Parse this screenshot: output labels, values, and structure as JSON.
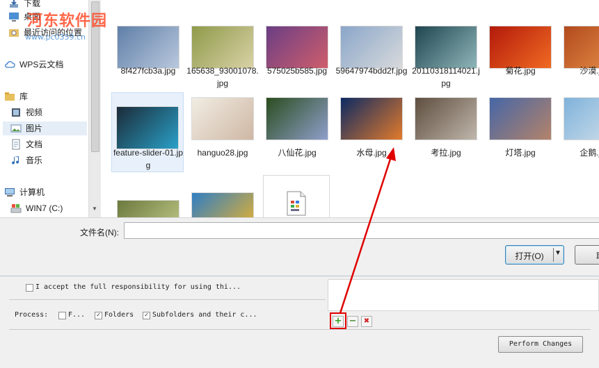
{
  "sidebar": {
    "items": [
      {
        "label": "下载",
        "icon": "download-icon"
      },
      {
        "label": "桌面",
        "icon": "desktop-icon"
      },
      {
        "label": "最近访问的位置",
        "icon": "recent-places-icon"
      },
      {
        "label": "WPS云文档",
        "icon": "cloud-icon"
      },
      {
        "label": "库",
        "icon": "library-icon"
      },
      {
        "label": "视频",
        "icon": "video-icon"
      },
      {
        "label": "图片",
        "icon": "pictures-icon"
      },
      {
        "label": "文档",
        "icon": "document-icon"
      },
      {
        "label": "音乐",
        "icon": "music-icon"
      },
      {
        "label": "计算机",
        "icon": "computer-icon"
      },
      {
        "label": "WIN7 (C:)",
        "icon": "drive-icon"
      }
    ]
  },
  "files": [
    {
      "name": "8f427fcb3a.jpg",
      "colors": [
        "#5f7fa8",
        "#b9c8dd"
      ]
    },
    {
      "name": "165638_93001078.jpg",
      "colors": [
        "#8f9a4a",
        "#d9d2a6"
      ]
    },
    {
      "name": "575025b585.jpg",
      "colors": [
        "#6a3e84",
        "#cf5e6c"
      ]
    },
    {
      "name": "59647974bdd2f.jpg",
      "colors": [
        "#8aa6c9",
        "#d8dadc"
      ]
    },
    {
      "name": "20110318114021.jpg",
      "colors": [
        "#1f4550",
        "#8fb6b9"
      ]
    },
    {
      "name": "菊花.jpg",
      "colors": [
        "#b31a0a",
        "#f06a23"
      ]
    },
    {
      "name": "沙漠.jpg",
      "colors": [
        "#b24a1d",
        "#e8924b"
      ]
    },
    {
      "name": "feature-slider-01.jpg",
      "colors": [
        "#1b2b38",
        "#2aa0c8"
      ]
    },
    {
      "name": "hanguo28.jpg",
      "colors": [
        "#f1ede3",
        "#cfb7a4"
      ]
    },
    {
      "name": "八仙花.jpg",
      "colors": [
        "#2b4d1f",
        "#8f9fcb"
      ]
    },
    {
      "name": "水母.jpg",
      "colors": [
        "#0c2a63",
        "#e37a2b"
      ]
    },
    {
      "name": "考拉.jpg",
      "colors": [
        "#5e4e3f",
        "#bfb6ab"
      ]
    },
    {
      "name": "灯塔.jpg",
      "colors": [
        "#4566a6",
        "#b4836a"
      ]
    },
    {
      "name": "企鹅.jpg",
      "colors": [
        "#7fb2da",
        "#d5e2ec"
      ]
    },
    {
      "name": "",
      "colors": [
        "#6b7a3e",
        "#c7cf8e"
      ]
    },
    {
      "name": "",
      "colors": [
        "#2f7ec3",
        "#f0b428"
      ]
    },
    {
      "name": "",
      "colors": [
        "#ffffff",
        "#ffffff"
      ]
    }
  ],
  "filename_label": "文件名(N):",
  "filename_value": "",
  "open_button": "打开(O)",
  "cancel_button": "取",
  "options": {
    "accept_label": "I accept the full responsibility for using thi...",
    "accept_checked": false,
    "process_label": "Process:",
    "files_option": "F...",
    "files_checked": false,
    "folders_option": "Folders",
    "folders_checked": true,
    "subfolders_option": "Subfolders and their c...",
    "subfolders_checked": true,
    "add_symbol": "+",
    "remove_symbol": "−",
    "delete_symbol": "✖",
    "perform_button": "Perform Changes"
  },
  "watermark": {
    "title": "河东软件园",
    "url": "www.pc0359.cn"
  },
  "colors": {
    "selection": "#e5eef7",
    "annotation_red": "#e00000",
    "add_green": "#2ea11f"
  }
}
